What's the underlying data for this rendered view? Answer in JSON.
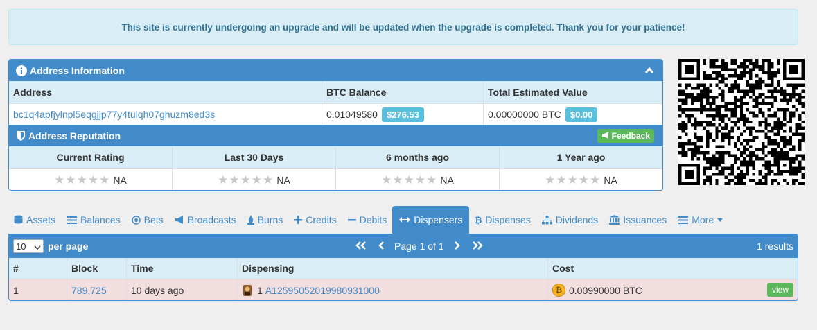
{
  "notice": "This site is currently undergoing an upgrade and will be updated when the upgrade is completed. Thank you for your patience!",
  "address_panel": {
    "title": "Address Information",
    "headers": {
      "address": "Address",
      "btc_balance": "BTC Balance",
      "total_value": "Total Estimated Value"
    },
    "address": "bc1q4apfjylnpl5eqgjjp77y4tulqh07ghuzm8ed3s",
    "btc_balance": "0.01049580",
    "btc_usd": "$276.53",
    "total_btc": "0.00000000 BTC",
    "total_usd": "$0.00"
  },
  "reputation": {
    "title": "Address Reputation",
    "feedback_label": "Feedback",
    "columns": [
      "Current Rating",
      "Last 30 Days",
      "6 months ago",
      "1 Year ago"
    ],
    "values": [
      "NA",
      "NA",
      "NA",
      "NA"
    ]
  },
  "tabs": [
    {
      "label": "Assets",
      "icon": "database-icon"
    },
    {
      "label": "Balances",
      "icon": "list-icon"
    },
    {
      "label": "Bets",
      "icon": "target-icon"
    },
    {
      "label": "Broadcasts",
      "icon": "bullhorn-icon"
    },
    {
      "label": "Burns",
      "icon": "fire-icon"
    },
    {
      "label": "Credits",
      "icon": "plus-icon"
    },
    {
      "label": "Debits",
      "icon": "minus-icon"
    },
    {
      "label": "Dispensers",
      "icon": "arrows-h-icon",
      "active": true
    },
    {
      "label": "Dispenses",
      "icon": "bitcoin-icon"
    },
    {
      "label": "Dividends",
      "icon": "sitemap-icon"
    },
    {
      "label": "Issuances",
      "icon": "bank-icon"
    },
    {
      "label": "More",
      "icon": "list-icon"
    }
  ],
  "pager": {
    "per_page_value": "10",
    "per_page_label": "per page",
    "page_text": "Page 1 of 1",
    "results": "1 results"
  },
  "table": {
    "headers": [
      "#",
      "Block",
      "Time",
      "Dispensing",
      "Cost"
    ],
    "rows": [
      {
        "num": "1",
        "block": "789,725",
        "time": "10 days ago",
        "dispensing_qty": "1",
        "asset": "A12595052019980931000",
        "cost": "0.00990000 BTC",
        "action": "view"
      }
    ]
  },
  "colors": {
    "primary": "#428bca",
    "info_bg": "#d9edf7",
    "success": "#5cb85c",
    "label_info": "#5bc0de",
    "danger_row": "#f2dede"
  }
}
